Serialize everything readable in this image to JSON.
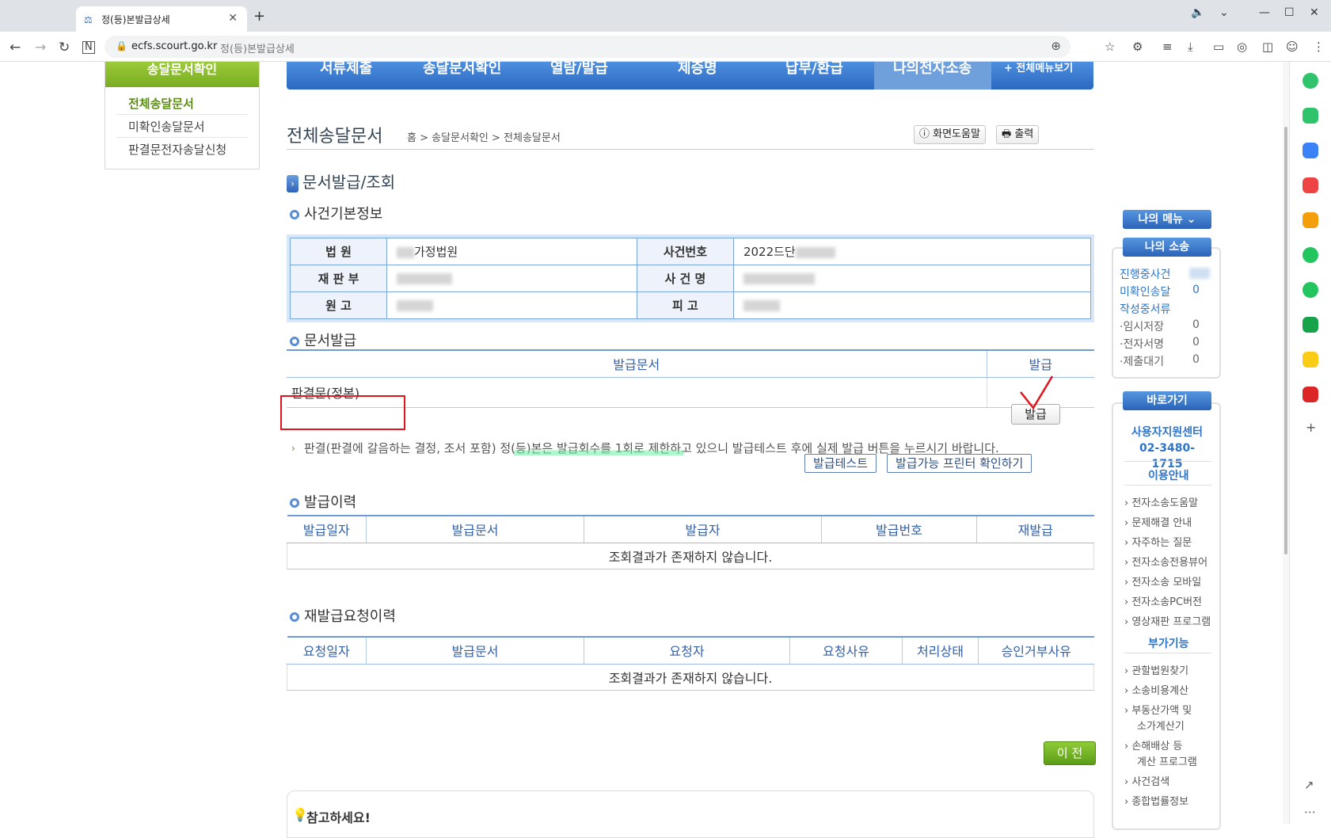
{
  "browser": {
    "tab_title": "정(등)본발급상세",
    "tab_close": "✕",
    "new_tab": "+",
    "url_domain": "ecfs.scourt.go.kr",
    "url_page_title": "정(등)본발급상세"
  },
  "left_menu": {
    "header": "송달문서확인",
    "items": [
      {
        "label": "전체송달문서",
        "active": true
      },
      {
        "label": "미확인송달문서",
        "active": false
      },
      {
        "label": "판결문전자송달신청",
        "active": false
      }
    ]
  },
  "gnb": {
    "items": [
      "서류제출",
      "송달문서확인",
      "열람/발급",
      "제증명",
      "납부/환급",
      "나의전자소송"
    ],
    "all_menu": "+ 전체메뉴보기"
  },
  "page": {
    "title": "전체송달문서",
    "breadcrumb": "홈 > 송달문서확인 > 전체송달문서",
    "help_button": "화면도움말",
    "print_button": "출력",
    "section_title": "문서발급/조회"
  },
  "case_info": {
    "heading": "사건기본정보",
    "court_label": "법 원",
    "court_value": "가정법원",
    "case_no_label": "사건번호",
    "case_no_value": "2022드단",
    "division_label": "재 판 부",
    "case_name_label": "사 건 명",
    "plaintiff_label": "원 고",
    "defendant_label": "피 고"
  },
  "issue": {
    "heading": "문서발급",
    "columns": [
      "발급문서",
      "발급"
    ],
    "rows": [
      {
        "document": "판결문(정본)",
        "button": "발급"
      }
    ],
    "notice": "판결(판결에 갈음하는 결정, 조서 포함) 정(등)본은 발급회수를 1회로 제한하고 있으니 발급테스트 후에 실제 발급 버튼을 누르시기 바랍니다.",
    "test_button": "발급테스트",
    "printer_button": "발급가능 프린터 확인하기"
  },
  "history": {
    "heading": "발급이력",
    "columns": [
      "발급일자",
      "발급문서",
      "발급자",
      "발급번호",
      "재발급"
    ],
    "empty": "조회결과가 존재하지 않습니다."
  },
  "reissue": {
    "heading": "재발급요청이력",
    "columns": [
      "요청일자",
      "발급문서",
      "요청자",
      "요청사유",
      "처리상태",
      "승인거부사유"
    ],
    "empty": "조회결과가 존재하지 않습니다."
  },
  "prev_button": "이 전",
  "tip": {
    "title": "참고하세요!"
  },
  "right_panel": {
    "my_menu": "나의 메뉴",
    "my_case": "나의 소송",
    "case_rows": [
      {
        "label": "진행중사건",
        "value": ""
      },
      {
        "label": "미확인송달",
        "value": "0"
      },
      {
        "label": "작성중서류",
        "value": ""
      },
      {
        "label": "·임시저장",
        "value": "0"
      },
      {
        "label": "·전자서명",
        "value": "0"
      },
      {
        "label": "·제출대기",
        "value": "0"
      }
    ],
    "shortcut": "바로가기",
    "support_center": "사용자지원센터",
    "phone": "02-3480-1715",
    "usage_heading": "이용안내",
    "usage_links": [
      "전자소송도움말",
      "문제해결 안내",
      "자주하는 질문",
      "전자소송전용뷰어",
      "전자소송 모바일",
      "전자소송PC버전",
      "영상재판 프로그램"
    ],
    "extra_heading": "부가기능",
    "extra_links": [
      "관할법원찾기",
      "소송비용계산",
      "부동산가액 및",
      "소가계산기",
      "손해배상 등",
      "계산 프로그램",
      "사건검색",
      "종합법률정보"
    ]
  }
}
